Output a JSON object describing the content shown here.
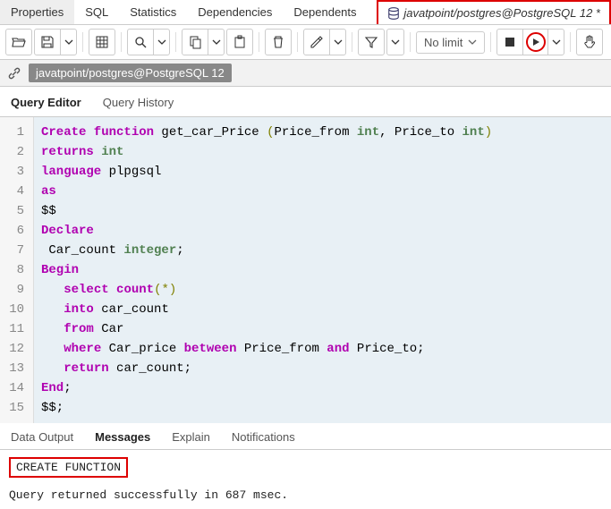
{
  "topnav": {
    "items": [
      "Properties",
      "SQL",
      "Statistics",
      "Dependencies",
      "Dependents"
    ],
    "connection_tab": "javatpoint/postgres@PostgreSQL 12 *"
  },
  "toolbar": {
    "limit_label": "No limit"
  },
  "connbar": {
    "text": "javatpoint/postgres@PostgreSQL 12"
  },
  "editor_tabs": {
    "query_editor": "Query Editor",
    "query_history": "Query History"
  },
  "code": {
    "lines": [
      [
        {
          "t": "Create function",
          "c": "kw"
        },
        {
          "t": " get_car_Price ",
          "c": "fn"
        },
        {
          "t": "(",
          "c": "op"
        },
        {
          "t": "Price_from ",
          "c": "txt"
        },
        {
          "t": "int",
          "c": "ty"
        },
        {
          "t": ", Price_to ",
          "c": "txt"
        },
        {
          "t": "int",
          "c": "ty"
        },
        {
          "t": ")",
          "c": "op"
        }
      ],
      [
        {
          "t": "returns",
          "c": "kw"
        },
        {
          "t": " ",
          "c": "txt"
        },
        {
          "t": "int",
          "c": "ty"
        }
      ],
      [
        {
          "t": "language",
          "c": "kw"
        },
        {
          "t": " plpgsql",
          "c": "txt"
        }
      ],
      [
        {
          "t": "as",
          "c": "kw"
        }
      ],
      [
        {
          "t": "$$",
          "c": "txt"
        }
      ],
      [
        {
          "t": "Declare",
          "c": "kw"
        }
      ],
      [
        {
          "t": " Car_count ",
          "c": "txt"
        },
        {
          "t": "integer",
          "c": "ty"
        },
        {
          "t": ";",
          "c": "txt"
        }
      ],
      [
        {
          "t": "Begin",
          "c": "kw"
        }
      ],
      [
        {
          "t": "   ",
          "c": "txt"
        },
        {
          "t": "select",
          "c": "kw"
        },
        {
          "t": " ",
          "c": "txt"
        },
        {
          "t": "count",
          "c": "kw"
        },
        {
          "t": "(",
          "c": "op"
        },
        {
          "t": "*",
          "c": "op"
        },
        {
          "t": ")",
          "c": "op"
        }
      ],
      [
        {
          "t": "   ",
          "c": "txt"
        },
        {
          "t": "into",
          "c": "kw"
        },
        {
          "t": " car_count",
          "c": "txt"
        }
      ],
      [
        {
          "t": "   ",
          "c": "txt"
        },
        {
          "t": "from",
          "c": "kw"
        },
        {
          "t": " Car",
          "c": "txt"
        }
      ],
      [
        {
          "t": "   ",
          "c": "txt"
        },
        {
          "t": "where",
          "c": "kw"
        },
        {
          "t": " Car_price ",
          "c": "txt"
        },
        {
          "t": "between",
          "c": "kw"
        },
        {
          "t": " Price_from ",
          "c": "txt"
        },
        {
          "t": "and",
          "c": "kw"
        },
        {
          "t": " Price_to;",
          "c": "txt"
        }
      ],
      [
        {
          "t": "   ",
          "c": "txt"
        },
        {
          "t": "return",
          "c": "kw"
        },
        {
          "t": " car_count;",
          "c": "txt"
        }
      ],
      [
        {
          "t": "End",
          "c": "kw"
        },
        {
          "t": ";",
          "c": "txt"
        }
      ],
      [
        {
          "t": "$$;",
          "c": "txt"
        }
      ]
    ]
  },
  "output_tabs": {
    "data_output": "Data Output",
    "messages": "Messages",
    "explain": "Explain",
    "notifications": "Notifications"
  },
  "output": {
    "result": "CREATE FUNCTION",
    "status": "Query returned successfully in 687 msec."
  }
}
